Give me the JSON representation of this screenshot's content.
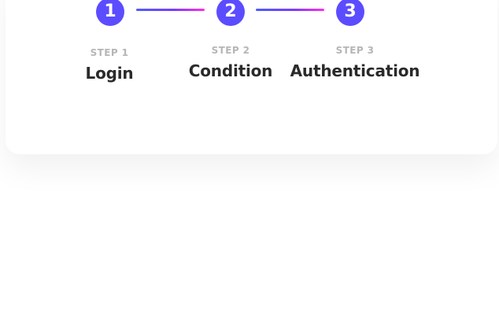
{
  "stepper": {
    "steps": [
      {
        "number": "1",
        "kicker": "STEP 1",
        "title": "Login"
      },
      {
        "number": "2",
        "kicker": "STEP 2",
        "title": "Condition"
      },
      {
        "number": "3",
        "kicker": "STEP 3",
        "title": "Authentication"
      }
    ]
  },
  "colors": {
    "primary": "#5b4cff",
    "connector_start": "#4f5cff",
    "connector_end": "#ff2fe6",
    "kicker_text": "#b6b6b6",
    "title_text": "#2a2a2a"
  }
}
